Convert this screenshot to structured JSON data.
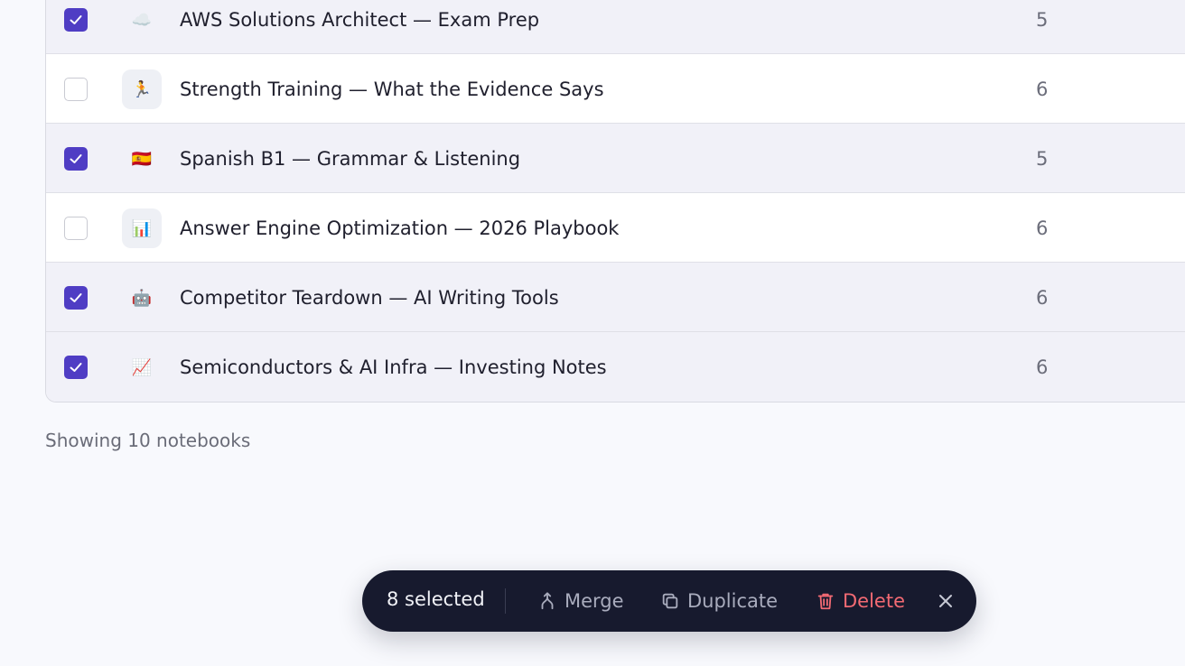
{
  "notebooks": [
    {
      "title": "AWS Solutions Architect — Exam Prep",
      "emoji": "☁️",
      "count": "5",
      "selected": true
    },
    {
      "title": "Strength Training — What the Evidence Says",
      "emoji": "🏃",
      "count": "6",
      "selected": false
    },
    {
      "title": "Spanish B1 — Grammar & Listening",
      "emoji": "🇪🇸",
      "count": "5",
      "selected": true
    },
    {
      "title": "Answer Engine Optimization — 2026 Playbook",
      "emoji": "📊",
      "count": "6",
      "selected": false
    },
    {
      "title": "Competitor Teardown — AI Writing Tools",
      "emoji": "🤖",
      "count": "6",
      "selected": true
    },
    {
      "title": "Semiconductors & AI Infra — Investing Notes",
      "emoji": "📈",
      "count": "6",
      "selected": true
    }
  ],
  "footer": {
    "text": "Showing 10 notebooks"
  },
  "action_bar": {
    "selected_label": "8 selected",
    "merge_label": "Merge",
    "duplicate_label": "Duplicate",
    "delete_label": "Delete",
    "delete_color": "#f26a73",
    "accent_color": "#4f3dc4"
  }
}
